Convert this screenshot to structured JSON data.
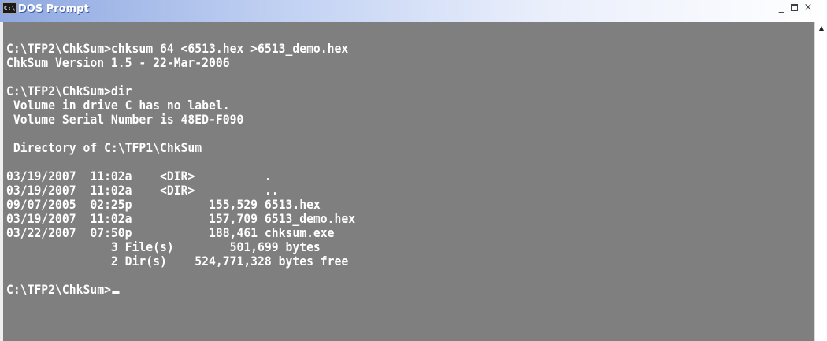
{
  "window": {
    "title": "DOS Prompt",
    "icon": "c-prompt-icon",
    "icon_text": "C:\\",
    "minimize_glyph": "_",
    "close_glyph": "×"
  },
  "console": {
    "text_color": "#ffffff",
    "background": "#7f7f7f",
    "lines": [
      "",
      "C:\\TFP2\\ChkSum>chksum 64 <6513.hex >6513_demo.hex",
      "ChkSum Version 1.5 - 22-Mar-2006",
      "",
      "C:\\TFP2\\ChkSum>dir",
      " Volume in drive C has no label.",
      " Volume Serial Number is 48ED-F090",
      "",
      " Directory of C:\\TFP1\\ChkSum",
      "",
      "03/19/2007  11:02a    <DIR>          .",
      "03/19/2007  11:02a    <DIR>          ..",
      "09/07/2005  02:25p           155,529 6513.hex",
      "03/19/2007  11:02a           157,709 6513_demo.hex",
      "03/22/2007  07:50p           188,461 chksum.exe",
      "               3 File(s)        501,699 bytes",
      "               2 Dir(s)    524,771,328 bytes free",
      ""
    ],
    "prompt": "C:\\TFP2\\ChkSum>"
  },
  "scrollbar": {
    "up_arrow": "▲"
  }
}
